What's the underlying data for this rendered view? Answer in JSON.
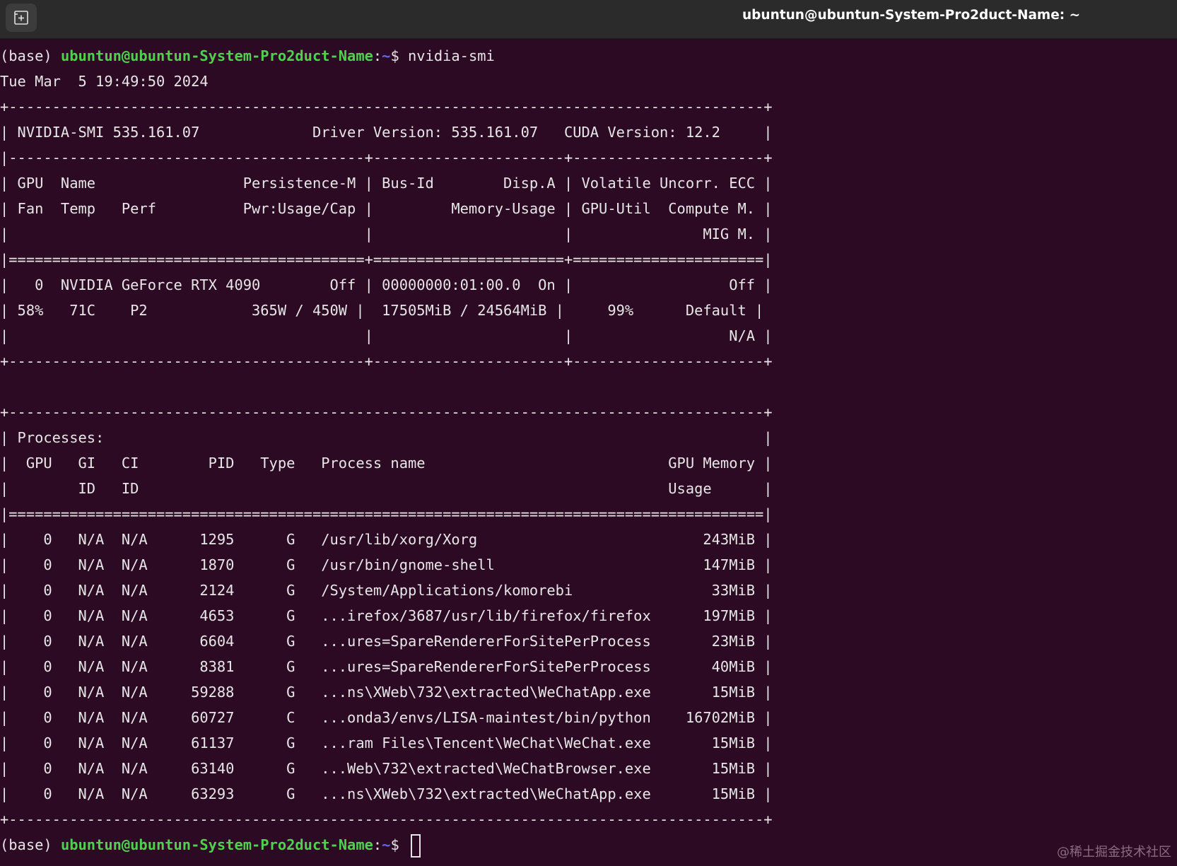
{
  "window": {
    "title": "ubuntun@ubuntun-System-Pro2duct-Name: ~",
    "new_tab_icon": "new-tab-icon"
  },
  "terminal": {
    "prompt_prefix": "(base) ",
    "prompt_user_host": "ubuntun@ubuntun-System-Pro2duct-Name",
    "prompt_colon": ":",
    "prompt_path": "~",
    "prompt_symbol": "$ ",
    "command": "nvidia-smi",
    "lines": [
      "Tue Mar  5 19:49:50 2024",
      "+---------------------------------------------------------------------------------------+",
      "| NVIDIA-SMI 535.161.07             Driver Version: 535.161.07   CUDA Version: 12.2     |",
      "|-----------------------------------------+----------------------+----------------------+",
      "| GPU  Name                 Persistence-M | Bus-Id        Disp.A | Volatile Uncorr. ECC |",
      "| Fan  Temp   Perf          Pwr:Usage/Cap |         Memory-Usage | GPU-Util  Compute M. |",
      "|                                         |                      |               MIG M. |",
      "|=========================================+======================+======================|",
      "|   0  NVIDIA GeForce RTX 4090        Off | 00000000:01:00.0  On |                  Off |",
      "| 58%   71C    P2            365W / 450W |  17505MiB / 24564MiB |     99%      Default |",
      "|                                         |                      |                  N/A |",
      "+-----------------------------------------+----------------------+----------------------+",
      "",
      "+---------------------------------------------------------------------------------------+",
      "| Processes:                                                                            |",
      "|  GPU   GI   CI        PID   Type   Process name                            GPU Memory |",
      "|        ID   ID                                                             Usage      |",
      "|=======================================================================================|",
      "|    0   N/A  N/A      1295      G   /usr/lib/xorg/Xorg                          243MiB |",
      "|    0   N/A  N/A      1870      G   /usr/bin/gnome-shell                        147MiB |",
      "|    0   N/A  N/A      2124      G   /System/Applications/komorebi                33MiB |",
      "|    0   N/A  N/A      4653      G   ...irefox/3687/usr/lib/firefox/firefox      197MiB |",
      "|    0   N/A  N/A      6604      G   ...ures=SpareRendererForSitePerProcess       23MiB |",
      "|    0   N/A  N/A      8381      G   ...ures=SpareRendererForSitePerProcess       40MiB |",
      "|    0   N/A  N/A     59288      G   ...ns\\XWeb\\732\\extracted\\WeChatApp.exe       15MiB |",
      "|    0   N/A  N/A     60727      C   ...onda3/envs/LISA-maintest/bin/python    16702MiB |",
      "|    0   N/A  N/A     61137      G   ...ram Files\\Tencent\\WeChat\\WeChat.exe       15MiB |",
      "|    0   N/A  N/A     63140      G   ...Web\\732\\extracted\\WeChatBrowser.exe       15MiB |",
      "|    0   N/A  N/A     63293      G   ...ns\\XWeb\\732\\extracted\\WeChatApp.exe       15MiB |",
      "+---------------------------------------------------------------------------------------+"
    ]
  },
  "watermark": "@稀土掘金技术社区",
  "colors": {
    "background": "#2d0a24",
    "titlebar": "#2b2b2b",
    "prompt_user": "#4fd04f",
    "prompt_path": "#5a6cf0",
    "text": "#e6e6e6"
  }
}
